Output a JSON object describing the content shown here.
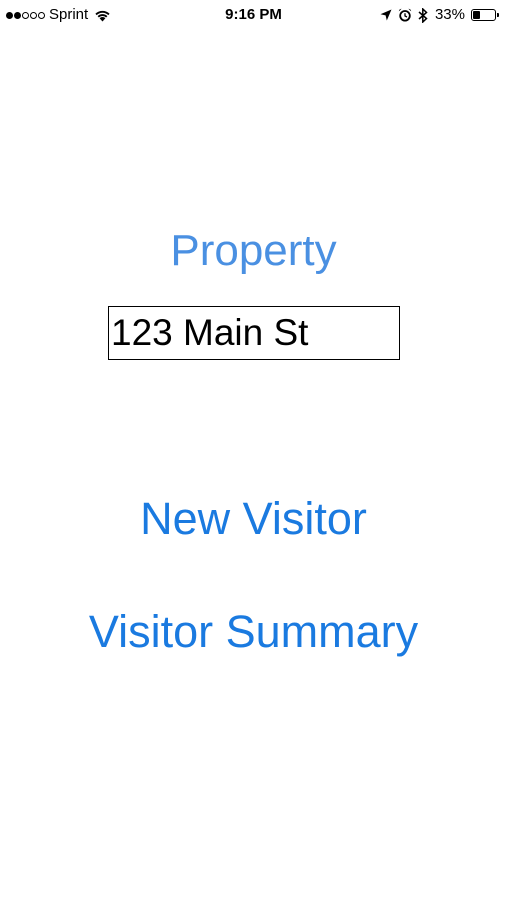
{
  "status_bar": {
    "signal_bars_filled": 2,
    "signal_bars_total": 5,
    "carrier": "Sprint",
    "wifi_icon": "wifi-icon",
    "time": "9:16 PM",
    "location_icon": "location-arrow-icon",
    "alarm_icon": "alarm-clock-icon",
    "bluetooth_icon": "bluetooth-icon",
    "battery_percent": "33%",
    "battery_level": 0.33
  },
  "main": {
    "property_label": "Property",
    "property_value": "123 Main St",
    "new_visitor_label": "New Visitor",
    "visitor_summary_label": "Visitor Summary"
  },
  "colors": {
    "label_blue": "#4a90e2",
    "button_blue": "#1a7ae0"
  }
}
